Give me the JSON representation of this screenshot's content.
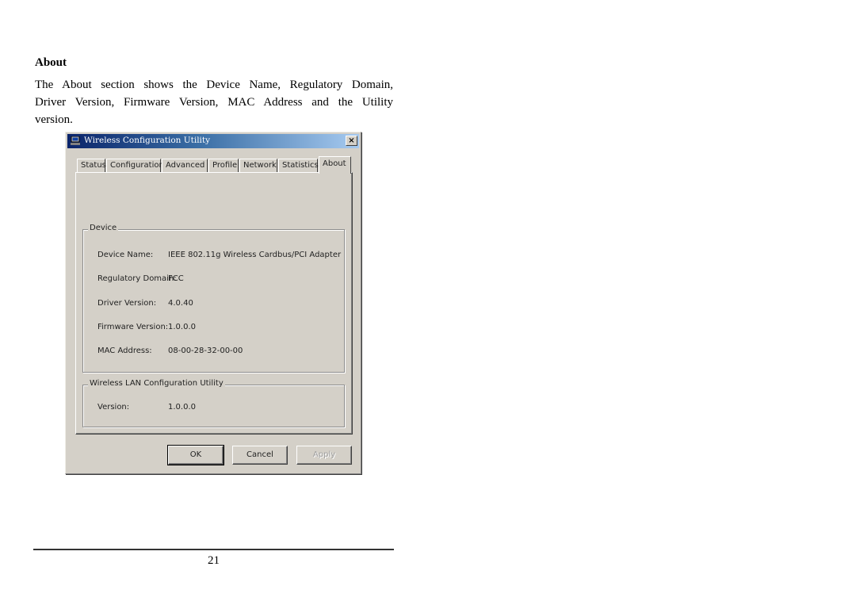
{
  "document": {
    "heading": "About",
    "paragraph_lines": [
      "The About section shows the Device Name, Regulatory Domain,",
      "Driver Version, Firmware Version, MAC Address and the Utility",
      "version."
    ],
    "page_number": "21"
  },
  "window": {
    "title": "Wireless Configuration Utility",
    "title_icon": "network-adapter-icon",
    "close_label": "×",
    "tabs": [
      {
        "label": "Status"
      },
      {
        "label": "Configuration"
      },
      {
        "label": "Advanced"
      },
      {
        "label": "Profile"
      },
      {
        "label": "Network"
      },
      {
        "label": "Statistics"
      },
      {
        "label": "About",
        "active": true
      }
    ],
    "device_group": {
      "title": "Device",
      "rows": [
        {
          "label": "Device Name:",
          "value": "IEEE 802.11g Wireless Cardbus/PCI Adapter"
        },
        {
          "label": "Regulatory Domain:",
          "value": "FCC"
        },
        {
          "label": "Driver Version:",
          "value": "4.0.40"
        },
        {
          "label": "Firmware Version:",
          "value": "1.0.0.0"
        },
        {
          "label": "MAC Address:",
          "value": "08-00-28-32-00-00"
        }
      ]
    },
    "utility_group": {
      "title": "Wireless LAN Configuration Utility",
      "rows": [
        {
          "label": "Version:",
          "value": "1.0.0.0"
        }
      ]
    },
    "buttons": {
      "ok": "OK",
      "cancel": "Cancel",
      "apply": "Apply"
    }
  }
}
